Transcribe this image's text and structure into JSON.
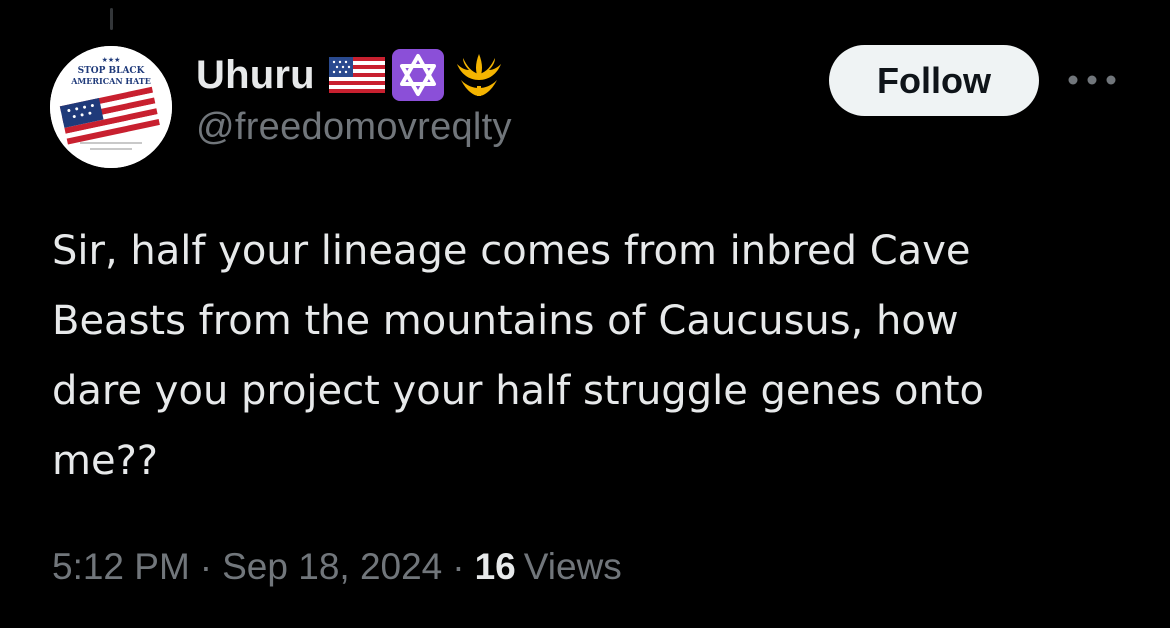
{
  "author": {
    "display_name": "Uhuru",
    "handle": "@freedomovreqlty",
    "avatar": {
      "icon": "flag-avatar-icon",
      "text_top": "STOP BLACK",
      "text_bottom": "AMERICAN HATE"
    },
    "badges": [
      "us-flag-icon",
      "star-of-david-icon",
      "rebel-alliance-icon"
    ]
  },
  "actions": {
    "follow_label": "Follow",
    "more_icon": "more-dots-icon"
  },
  "tweet": {
    "lines": [
      "Sir, half your lineage comes from inbred Cave",
      "Beasts from the mountains of Caucusus, how",
      "dare you project your half struggle genes onto",
      "me??"
    ]
  },
  "meta": {
    "time": "5:12 PM",
    "separator": "·",
    "date": "Sep 18, 2024",
    "views_count": "16",
    "views_label": "Views"
  },
  "colors": {
    "background": "#000000",
    "primary_text": "#e7e9ea",
    "secondary_text": "#71767b",
    "follow_bg": "#eff3f4",
    "badge_star_bg": "#8b4fd8",
    "badge_rebel": "#f4b400"
  }
}
